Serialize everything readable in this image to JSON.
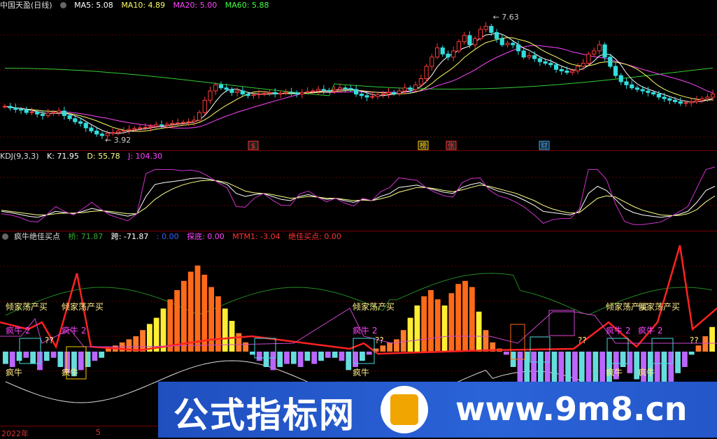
{
  "panel1": {
    "title": "中国天盈(日线)",
    "ma": [
      {
        "label": "MA5: 5.08",
        "color": "#ffffff"
      },
      {
        "label": "MA10: 4.89",
        "color": "#ffff66"
      },
      {
        "label": "MA20: 5.00",
        "color": "#ff44ff"
      },
      {
        "label": "MA60: 5.88",
        "color": "#44ff44"
      }
    ],
    "high_label": "7.63",
    "low_label": "3.92",
    "badges": [
      {
        "text": "$",
        "color": "#ff3333"
      },
      {
        "text": "榜",
        "color": "#ffcc00"
      },
      {
        "text": "张",
        "color": "#ff3333"
      },
      {
        "text": "财",
        "color": "#33aaff"
      }
    ]
  },
  "panel2": {
    "legend": [
      {
        "label": "KDJ(9,3,3)",
        "color": "#dddddd"
      },
      {
        "label": "K: 71.95",
        "color": "#ffffff"
      },
      {
        "label": "D: 55.78",
        "color": "#ffff88"
      },
      {
        "label": "J: 104.30",
        "color": "#ff44ff"
      }
    ]
  },
  "panel3": {
    "legend": [
      {
        "label": "疯牛绝佳买点",
        "color": "#dddddd"
      },
      {
        "label": "桥: 71.87",
        "color": "#33aa33"
      },
      {
        "label": "跨: -71.87",
        "color": "#ffffff"
      },
      {
        "label": ": 0.00",
        "color": "#3366ff"
      },
      {
        "label": "探底: 0.00",
        "color": "#ff44ff"
      },
      {
        "label": "MTM1: -3.04",
        "color": "#ff3333"
      },
      {
        "label": "绝佳买点: 0.00",
        "color": "#ff3333"
      }
    ],
    "signal_texts": {
      "qingjia": "倾家荡产买",
      "fengniu2": "疯牛 2",
      "fengniu": "疯牛",
      "qq": "??"
    }
  },
  "axis": {
    "year": "2022年",
    "month": "5"
  },
  "watermark": {
    "left": "公式指标网",
    "right": "www.9m8.cn"
  },
  "chart_data": [
    {
      "type": "candlestick",
      "title": "中国天盈(日线)",
      "indicators": {
        "MA5": 5.08,
        "MA10": 4.89,
        "MA20": 5.0,
        "MA60": 5.88
      },
      "annotations": {
        "high": 7.63,
        "low": 3.92
      },
      "ylim": [
        3.7,
        7.9
      ],
      "close": [
        4.9,
        4.85,
        4.8,
        4.78,
        4.7,
        4.72,
        4.65,
        4.6,
        4.68,
        4.7,
        4.75,
        4.6,
        4.5,
        4.4,
        4.35,
        4.2,
        4.1,
        4.0,
        3.95,
        4.02,
        4.05,
        4.1,
        4.12,
        4.15,
        4.18,
        4.2,
        4.22,
        4.25,
        4.3,
        4.28,
        4.32,
        4.35,
        4.36,
        4.38,
        4.4,
        4.45,
        4.7,
        5.1,
        5.4,
        5.6,
        5.5,
        5.45,
        5.35,
        5.4,
        5.3,
        5.25,
        5.28,
        5.3,
        5.32,
        5.35,
        5.3,
        5.33,
        5.36,
        5.34,
        5.3,
        5.35,
        5.38,
        5.4,
        5.45,
        5.42,
        5.4,
        5.45,
        5.5,
        5.48,
        5.45,
        5.3,
        5.25,
        5.2,
        5.22,
        5.28,
        5.3,
        5.35,
        5.32,
        5.4,
        5.5,
        5.45,
        5.6,
        5.8,
        6.2,
        6.5,
        6.8,
        6.6,
        6.5,
        6.7,
        7.0,
        7.2,
        6.9,
        7.1,
        7.4,
        7.5,
        7.3,
        7.1,
        6.9,
        6.95,
        6.9,
        6.7,
        6.5,
        6.55,
        6.45,
        6.35,
        6.3,
        6.25,
        6.1,
        6.05,
        6.0,
        6.05,
        6.2,
        6.3,
        6.6,
        6.7,
        6.9,
        6.5,
        6.2,
        5.9,
        5.7,
        5.6,
        5.5,
        5.45,
        5.4,
        5.35,
        5.3,
        5.2,
        5.15,
        5.1,
        5.05,
        5.0,
        5.02,
        5.05,
        5.1,
        5.15,
        5.2,
        5.3
      ]
    },
    {
      "type": "line",
      "title": "KDJ(9,3,3)",
      "series": [
        {
          "name": "K",
          "values": [
            30,
            28,
            25,
            22,
            20,
            24,
            30,
            28,
            26,
            30,
            35,
            32,
            28,
            25,
            22,
            26,
            55,
            75,
            78,
            80,
            82,
            85,
            86,
            84,
            80,
            75,
            60,
            55,
            58,
            60,
            55,
            50,
            48,
            55,
            58,
            54,
            50,
            52,
            48,
            45,
            50,
            48,
            55,
            60,
            70,
            72,
            74,
            70,
            66,
            62,
            60,
            70,
            75,
            78,
            70,
            64,
            60,
            55,
            48,
            40,
            30,
            28,
            26,
            24,
            30,
            60,
            72,
            65,
            50,
            35,
            28,
            24,
            22,
            20,
            22,
            25,
            30,
            45,
            65,
            71.95
          ]
        },
        {
          "name": "D",
          "values": [
            32,
            30,
            28,
            26,
            24,
            24,
            26,
            27,
            27,
            28,
            30,
            31,
            30,
            28,
            26,
            26,
            36,
            50,
            60,
            68,
            74,
            78,
            81,
            82,
            81,
            78,
            71,
            64,
            61,
            60,
            58,
            55,
            52,
            53,
            55,
            54,
            52,
            52,
            50,
            48,
            49,
            48,
            51,
            55,
            62,
            66,
            70,
            70,
            68,
            65,
            63,
            66,
            70,
            74,
            72,
            68,
            64,
            60,
            54,
            48,
            40,
            34,
            30,
            27,
            28,
            40,
            52,
            56,
            54,
            46,
            38,
            32,
            28,
            24,
            23,
            23,
            26,
            33,
            46,
            55.78
          ]
        },
        {
          "name": "J",
          "values": [
            26,
            24,
            20,
            14,
            12,
            24,
            38,
            30,
            24,
            34,
            45,
            34,
            24,
            19,
            14,
            26,
            93,
            100,
            100,
            100,
            98,
            99,
            96,
            88,
            78,
            69,
            38,
            37,
            52,
            60,
            49,
            40,
            40,
            59,
            64,
            54,
            46,
            52,
            44,
            39,
            52,
            48,
            63,
            70,
            86,
            84,
            82,
            70,
            62,
            56,
            54,
            78,
            85,
            86,
            66,
            56,
            52,
            45,
            36,
            24,
            10,
            16,
            18,
            18,
            34,
            100,
            100,
            83,
            42,
            13,
            8,
            8,
            10,
            12,
            20,
            29,
            38,
            69,
            100,
            104.3
          ]
        }
      ]
    },
    {
      "type": "bar",
      "title": "疯牛绝佳买点",
      "indicators": {
        "桥": 71.87,
        "跨": -71.87,
        "": 0.0,
        "探底": 0.0,
        "MTM1": -3.04,
        "绝佳买点": 0.0
      },
      "values": [
        -8,
        -10,
        -6,
        -4,
        -8,
        -12,
        -6,
        -4,
        -10,
        -14,
        -16,
        -12,
        -10,
        -6,
        -4,
        2,
        4,
        6,
        8,
        10,
        14,
        18,
        22,
        28,
        34,
        40,
        46,
        52,
        56,
        50,
        42,
        36,
        28,
        20,
        12,
        6,
        -2,
        -6,
        -10,
        -12,
        -10,
        -8,
        -8,
        -10,
        -6,
        -8,
        -6,
        -4,
        -4,
        -6,
        -12,
        -10,
        -6,
        -2,
        2,
        4,
        6,
        8,
        14,
        22,
        30,
        36,
        40,
        34,
        30,
        38,
        44,
        46,
        42,
        26,
        14,
        6,
        2,
        -2,
        -10,
        -22,
        -30,
        -36,
        -40,
        -40,
        -38,
        -34,
        -30,
        -34,
        -40,
        -44,
        -38,
        -30,
        -24,
        -18,
        -10,
        -14,
        -18,
        -22,
        -26,
        -28,
        -24,
        -20,
        -14,
        -10,
        -2,
        4,
        10,
        16
      ]
    }
  ]
}
